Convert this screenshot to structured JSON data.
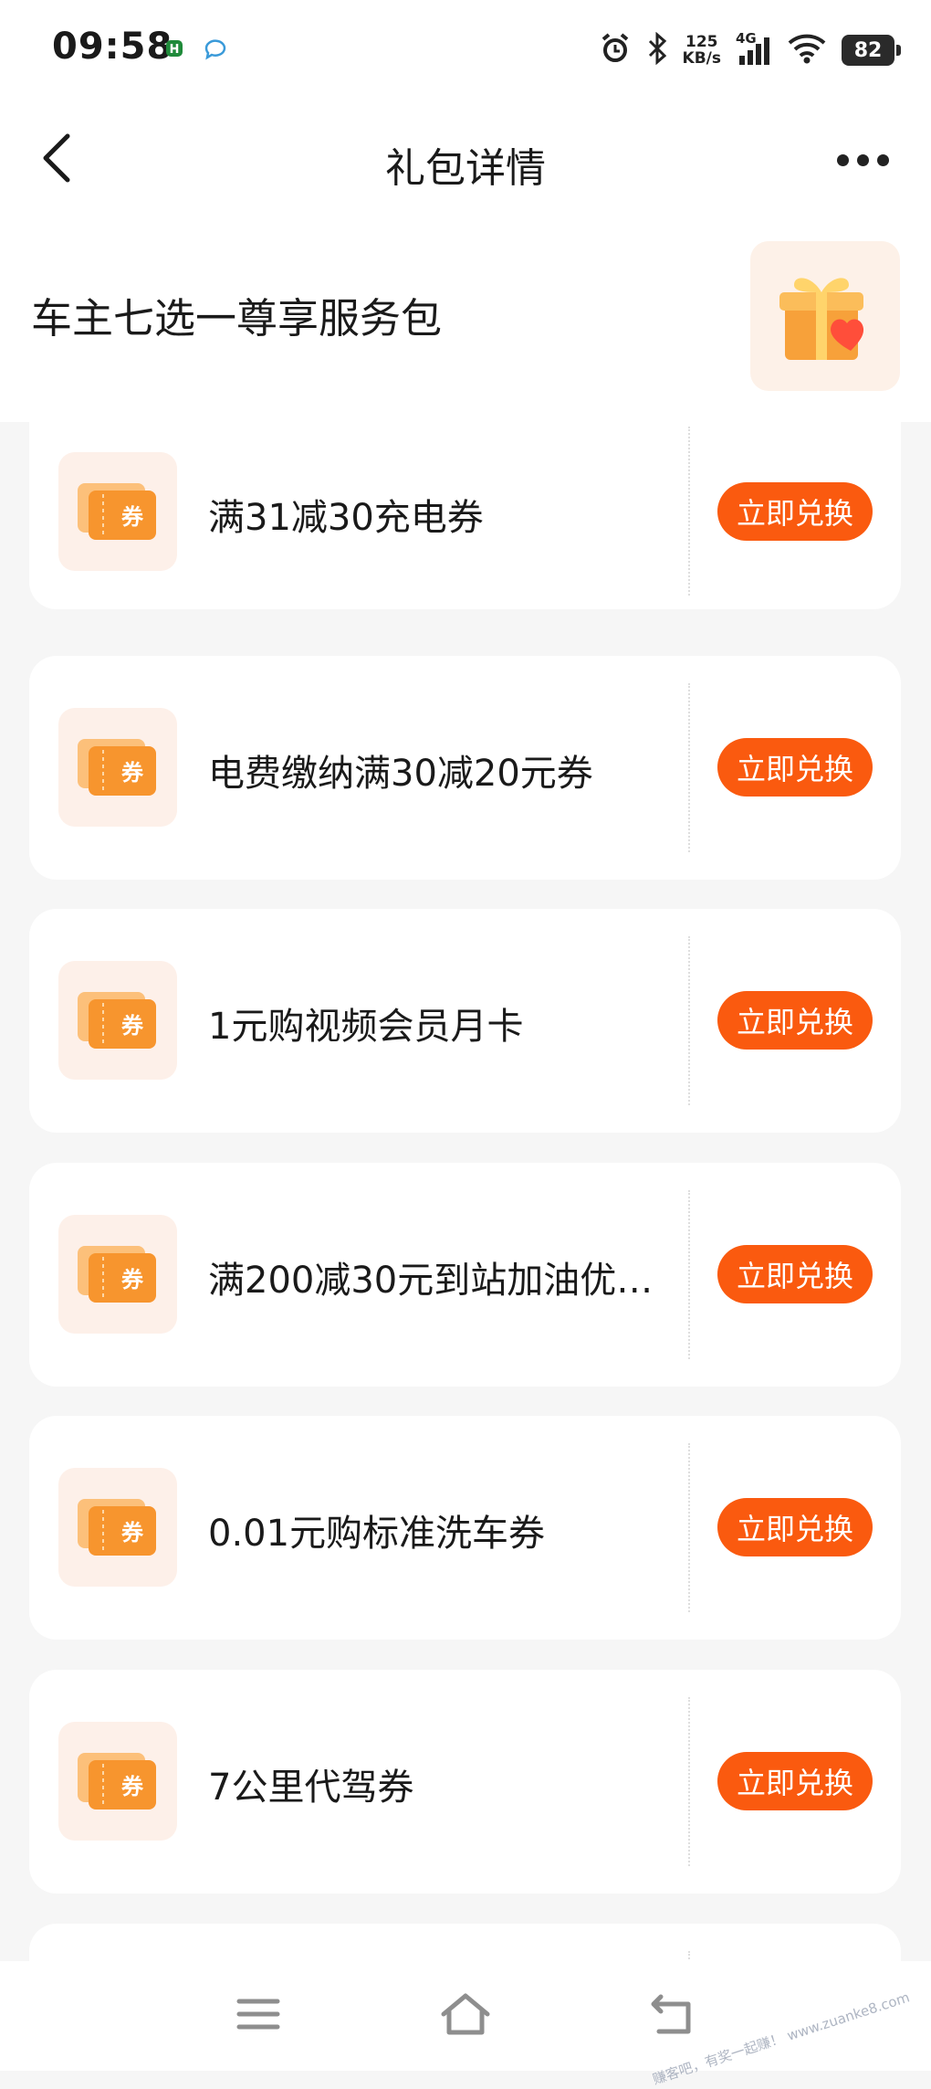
{
  "status_bar": {
    "time": "09:58",
    "speed_value": "125",
    "speed_unit": "KB/s",
    "network": "4G",
    "battery": "82"
  },
  "header": {
    "title": "礼包详情",
    "back_icon": "chevron-left-icon",
    "more_icon": "more-dots-icon"
  },
  "package": {
    "name": "车主七选一尊享服务包",
    "icon": "gift-box-icon"
  },
  "coupons": [
    {
      "name": "满31减30充电券",
      "button": "立即兑换",
      "tile_label": "券"
    },
    {
      "name": "电费缴纳满30减20元券",
      "button": "立即兑换",
      "tile_label": "券"
    },
    {
      "name": "1元购视频会员月卡",
      "button": "立即兑换",
      "tile_label": "券"
    },
    {
      "name": "满200减30元到站加油优…",
      "button": "立即兑换",
      "tile_label": "券"
    },
    {
      "name": "0.01元购标准洗车券",
      "button": "立即兑换",
      "tile_label": "券"
    },
    {
      "name": "7公里代驾券",
      "button": "立即兑换",
      "tile_label": "券"
    }
  ],
  "nav": {
    "menu_icon": "menu-icon",
    "home_icon": "home-icon",
    "back_icon": "return-icon"
  },
  "watermark": "赚客吧，有奖一起赚！ www.zuanke8.com",
  "colors": {
    "accent": "#fa5a0f",
    "coupon_tile_bg": "#fdf0e9",
    "page_bg": "#f6f6f6"
  }
}
